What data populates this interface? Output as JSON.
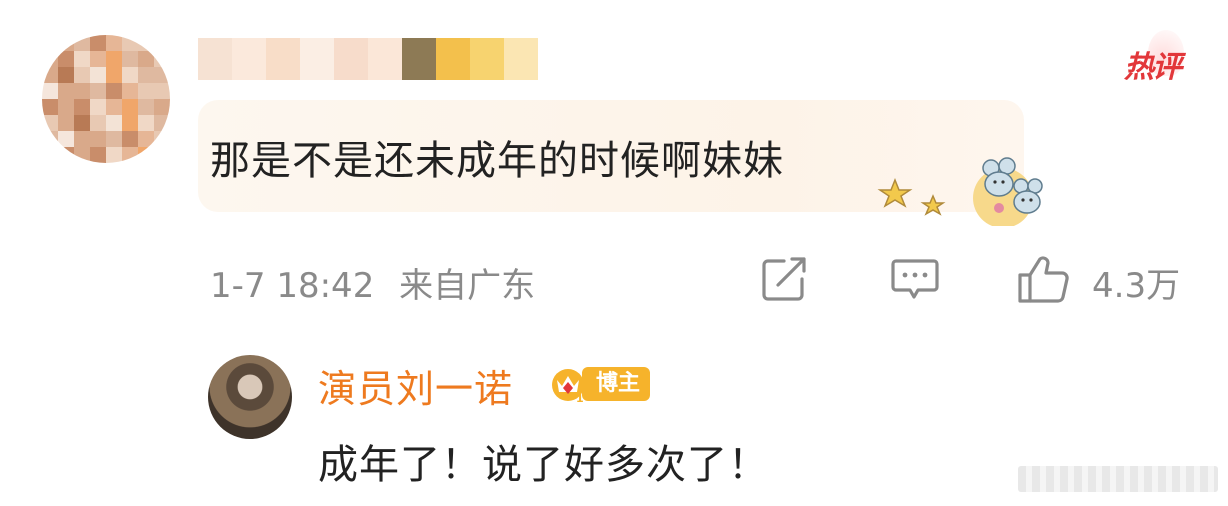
{
  "comment": {
    "badge_label": "热评",
    "text": "那是不是还未成年的时候啊妹妹",
    "time": "1-7 18:42",
    "location": "来自广东",
    "like_count": "4.3万",
    "icons": {
      "share": "share-icon",
      "reply": "comment-icon",
      "like": "thumbs-up-icon"
    }
  },
  "reply": {
    "author": "演员刘一诺",
    "author_tag": "博主",
    "badge_level": "1",
    "text": "成年了！说了好多次了！"
  },
  "colors": {
    "hot_badge": "#e2373a",
    "author_name": "#ee7a1f",
    "meta_text": "#8a8a8a",
    "bubble_bg": "#fdf5ec"
  }
}
